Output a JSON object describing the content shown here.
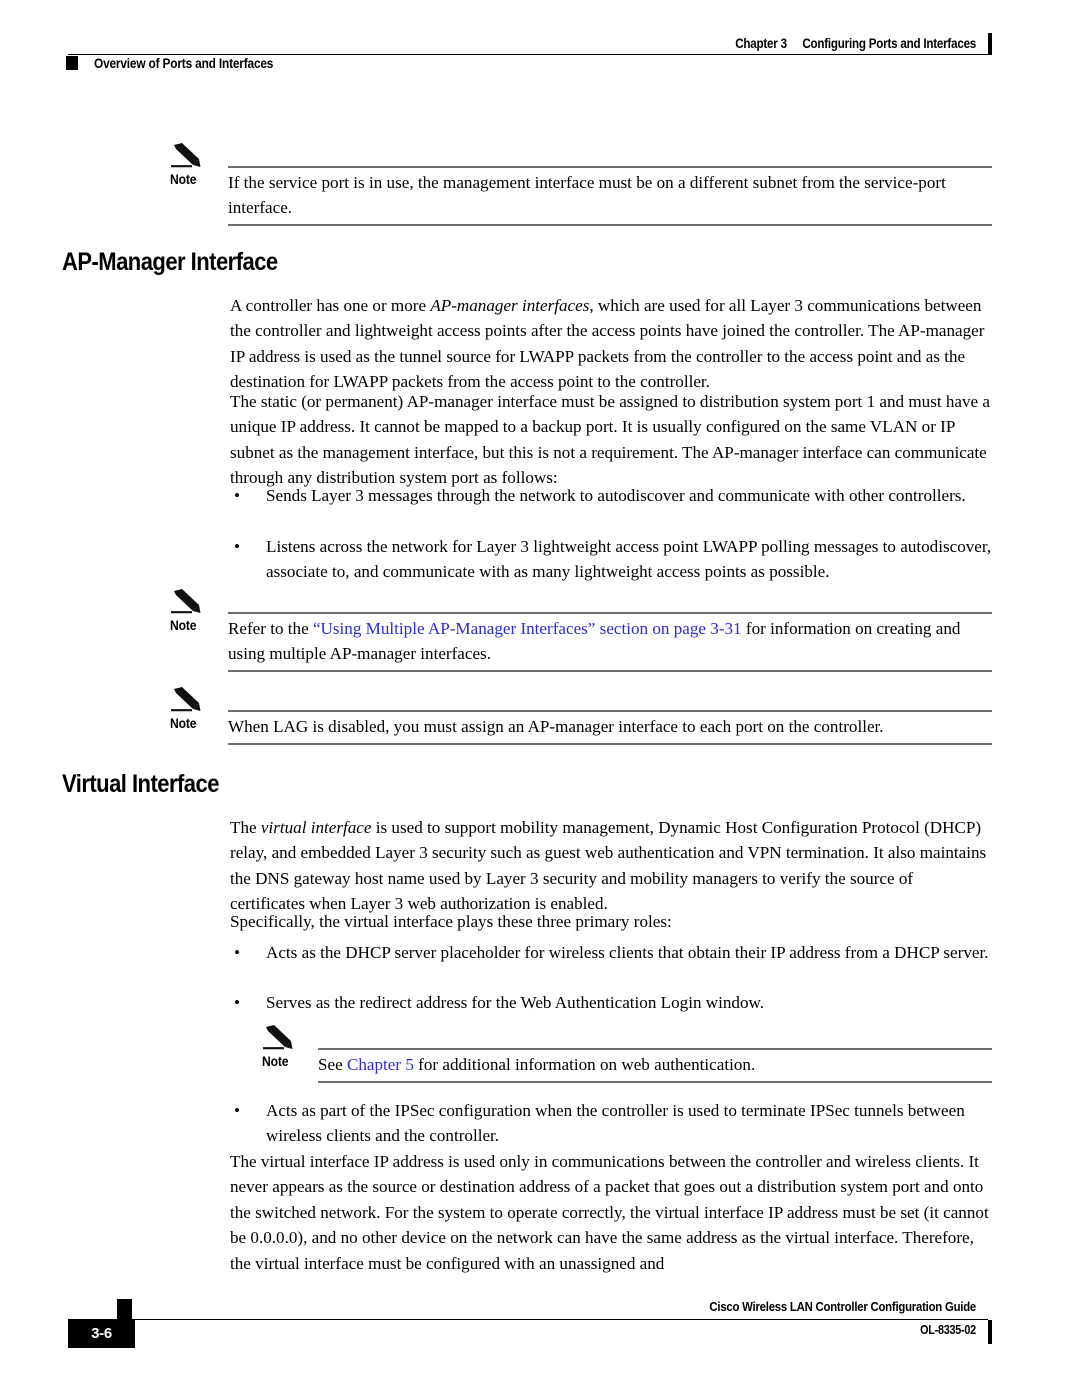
{
  "header": {
    "chapter_number": "Chapter 3",
    "chapter_title": "Configuring Ports and Interfaces",
    "section_title": "Overview of Ports and Interfaces"
  },
  "footer": {
    "page_number": "3-6",
    "guide_title": "Cisco Wireless LAN Controller Configuration Guide",
    "doc_id": "OL-8335-02"
  },
  "notes": {
    "label": "Note",
    "note1": "If the service port is in use, the management interface must be on a different subnet from the service-port interface.",
    "note2_pre": "Refer to the ",
    "note2_link": "“Using Multiple AP-Manager Interfaces” section on page 3-31",
    "note2_post": " for information on creating and using multiple AP-manager interfaces.",
    "note3": "When LAG is disabled, you must assign an AP-manager interface to each port on the controller.",
    "note4_pre": "See ",
    "note4_link": "Chapter 5",
    "note4_post": " for additional information on web authentication."
  },
  "sections": {
    "ap_manager": {
      "heading": "AP-Manager Interface",
      "para1_pre": "A controller has one or more ",
      "para1_italic": "AP-manager interfaces",
      "para1_post": ", which are used for all Layer 3 communications between the controller and lightweight access points after the access points have joined the controller. The AP-manager IP address is used as the tunnel source for LWAPP packets from the controller to the access point and as the destination for LWAPP packets from the access point to the controller.",
      "para2": "The static (or permanent) AP-manager interface must be assigned to distribution system port 1 and must have a unique IP address. It cannot be mapped to a backup port. It is usually configured on the same VLAN or IP subnet as the management interface, but this is not a requirement. The AP-manager interface can communicate through any distribution system port as follows:",
      "bullet1": "Sends Layer 3 messages through the network to autodiscover and communicate with other controllers.",
      "bullet2": "Listens across the network for Layer 3 lightweight access point LWAPP polling messages to autodiscover, associate to, and communicate with as many lightweight access points as possible."
    },
    "virtual": {
      "heading": "Virtual Interface",
      "para1_pre": "The ",
      "para1_italic": "virtual interface",
      "para1_post": " is used to support mobility management, Dynamic Host Configuration Protocol (DHCP) relay, and embedded Layer 3 security such as guest web authentication and VPN termination. It also maintains the DNS gateway host name used by Layer 3 security and mobility managers to verify the source of certificates when Layer 3 web authorization is enabled.",
      "para2": "Specifically, the virtual interface plays these three primary roles:",
      "bullet1": "Acts as the DHCP server placeholder for wireless clients that obtain their IP address from a DHCP server.",
      "bullet2": "Serves as the redirect address for the Web Authentication Login window.",
      "bullet3": "Acts as part of the IPSec configuration when the controller is used to terminate IPSec tunnels between wireless clients and the controller.",
      "para3": "The virtual interface IP address is used only in communications between the controller and wireless clients. It never appears as the source or destination address of a packet that goes out a distribution system port and onto the switched network. For the system to operate correctly, the virtual interface IP address must be set (it cannot be 0.0.0.0), and no other device on the network can have the same address as the virtual interface. Therefore, the virtual interface must be configured with an unassigned and"
    }
  },
  "glyphs": {
    "bullet": "•"
  },
  "colors": {
    "text": "#000000",
    "link": "#2B2BD6",
    "rule": "#6e6e6e"
  }
}
